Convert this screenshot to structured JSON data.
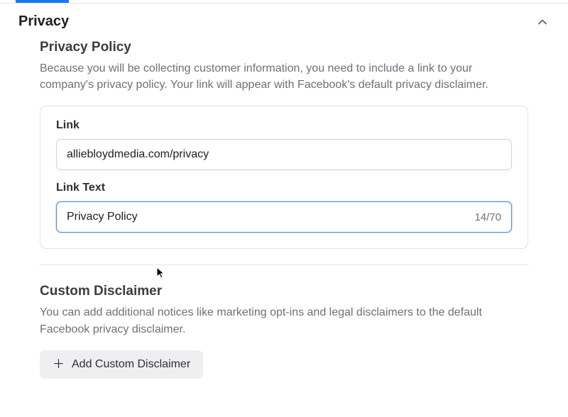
{
  "section": {
    "title": "Privacy"
  },
  "privacyPolicy": {
    "title": "Privacy Policy",
    "description": "Because you will be collecting customer information, you need to include a link to your company's privacy policy. Your link will appear with Facebook's default privacy disclaimer.",
    "linkLabel": "Link",
    "linkValue": "alliebloydmedia.com/privacy",
    "linkTextLabel": "Link Text",
    "linkTextValue": "Privacy Policy",
    "charCount": "14/70"
  },
  "customDisclaimer": {
    "title": "Custom Disclaimer",
    "description": "You can add additional notices like marketing opt-ins and legal disclaimers to the default Facebook privacy disclaimer.",
    "addButtonLabel": "Add Custom Disclaimer"
  }
}
